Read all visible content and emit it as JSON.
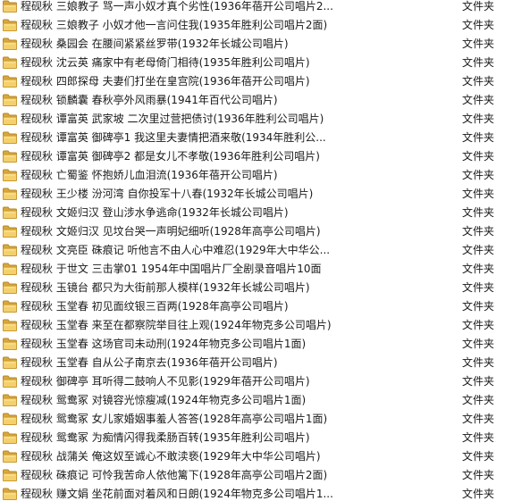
{
  "explorer": {
    "rows": [
      {
        "name": "程砚秋 三娘教子 骂一声小奴才真个劣性(1936年蓓开公司唱片2...",
        "type": "文件夹"
      },
      {
        "name": "程砚秋 三娘教子 小奴才他一言问住我(1935年胜利公司唱片2面)",
        "type": "文件夹"
      },
      {
        "name": "程砚秋 桑园会 在腰间紧紧丝罗带(1932年长城公司唱片)",
        "type": "文件夹"
      },
      {
        "name": "程砚秋 沈云英 痛家中有老母倚门相待(1935年胜利公司唱片)",
        "type": "文件夹"
      },
      {
        "name": "程砚秋 四郎探母 夫妻们打坐在皇宫院(1936年蓓开公司唱片)",
        "type": "文件夹"
      },
      {
        "name": "程砚秋 锁麟囊 春秋亭外风雨暴(1941年百代公司唱片)",
        "type": "文件夹"
      },
      {
        "name": "程砚秋 谭富英 武家坡 二次里过营把债讨(1936年胜利公司唱片)",
        "type": "文件夹"
      },
      {
        "name": "程砚秋 谭富英 御碑亭1 我这里夫妻情把酒来敬(1934年胜利公...",
        "type": "文件夹"
      },
      {
        "name": "程砚秋 谭富英 御碑亭2 都是女儿不孝敬(1936年胜利公司唱片)",
        "type": "文件夹"
      },
      {
        "name": "程砚秋 亡蜀鉴 怀抱娇儿血泪流(1936年蓓开公司唱片)",
        "type": "文件夹"
      },
      {
        "name": "程砚秋 王少楼 汾河湾 自你投军十八春(1932年长城公司唱片)",
        "type": "文件夹"
      },
      {
        "name": "程砚秋 文姬归汉 登山涉水争逃命(1932年长城公司唱片)",
        "type": "文件夹"
      },
      {
        "name": "程砚秋 文姬归汉 见坟台哭一声明妃细听(1928年高亭公司唱片)",
        "type": "文件夹"
      },
      {
        "name": "程砚秋 文亮臣 硃痕记 听他言不由人心中难忍(1929年大中华公...",
        "type": "文件夹"
      },
      {
        "name": "程砚秋 于世文 三击掌01 1954年中国唱片厂全剧录音唱片10面",
        "type": "文件夹"
      },
      {
        "name": "程砚秋 玉镜台 都只为大街前那人模样(1932年长城公司唱片)",
        "type": "文件夹"
      },
      {
        "name": "程砚秋 玉堂春 初见面纹银三百两(1928年高亭公司唱片)",
        "type": "文件夹"
      },
      {
        "name": "程砚秋 玉堂春 来至在都察院举目往上观(1924年物克多公司唱片)",
        "type": "文件夹"
      },
      {
        "name": "程砚秋 玉堂春 这场官司未动刑(1924年物克多公司唱片1面)",
        "type": "文件夹"
      },
      {
        "name": "程砚秋 玉堂春 自从公子南京去(1936年蓓开公司唱片)",
        "type": "文件夹"
      },
      {
        "name": "程砚秋 御碑亭 耳听得二鼓响人不见影(1929年蓓开公司唱片)",
        "type": "文件夹"
      },
      {
        "name": "程砚秋 鸳鸯冢 对镜容光惊瘦减(1924年物克多公司唱片1面)",
        "type": "文件夹"
      },
      {
        "name": "程砚秋 鸳鸯冢 女儿家婚姻事羞人答答(1928年高亭公司唱片1面)",
        "type": "文件夹"
      },
      {
        "name": "程砚秋 鸳鸯冢 为痴情闪得我柔肠百转(1935年胜利公司唱片)",
        "type": "文件夹"
      },
      {
        "name": "程砚秋 战蒲关 俺这奴至诚心不敢渎亵(1929年大中华公司唱片)",
        "type": "文件夹"
      },
      {
        "name": "程砚秋 硃痕记 可怜我苦命人依他篱下(1928年高亭公司唱片2面)",
        "type": "文件夹"
      },
      {
        "name": "程砚秋 赚文娟 坐花前面对着风和日朗(1924年物克多公司唱片1...",
        "type": "文件夹"
      }
    ]
  }
}
